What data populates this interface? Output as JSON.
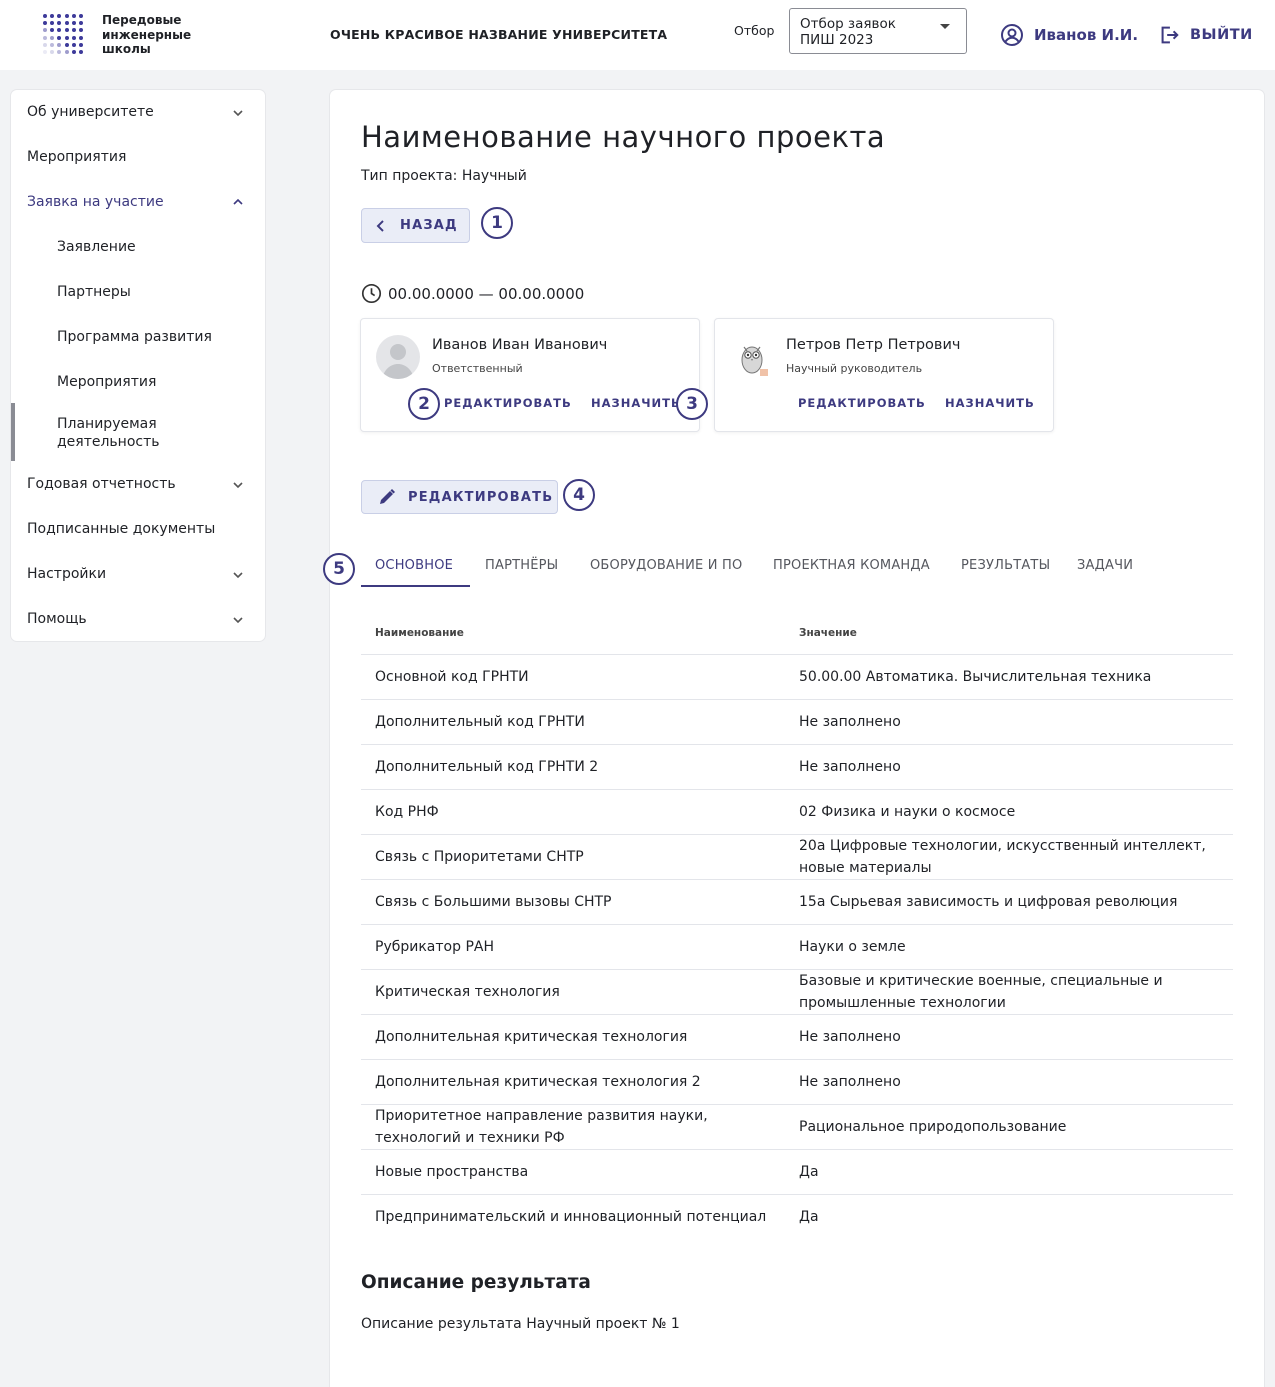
{
  "header": {
    "logo_text_lines": [
      "Передовые",
      "инженерные",
      "школы"
    ],
    "university": "ОЧЕНЬ КРАСИВОЕ НАЗВАНИЕ УНИВЕРСИТЕТА",
    "otbor_label": "Отбор",
    "select_value_line1": "Отбор заявок",
    "select_value_line2": "ПИШ 2023",
    "user_name": "Иванов И.И.",
    "logout": "ВЫЙТИ"
  },
  "sidebar": {
    "items": [
      {
        "label": "Об университете"
      },
      {
        "label": "Мероприятия"
      },
      {
        "label": "Заявка на участие"
      },
      {
        "label": "Годовая отчетность"
      },
      {
        "label": "Подписанные документы"
      },
      {
        "label": "Настройки"
      },
      {
        "label": "Помощь"
      }
    ],
    "subitems": [
      {
        "label": "Заявление"
      },
      {
        "label": "Партнеры"
      },
      {
        "label": "Программа развития"
      },
      {
        "label": "Мероприятия"
      },
      {
        "label": "Планируемая деятельность"
      }
    ]
  },
  "project": {
    "title": "Наименование научного проекта",
    "type": "Тип проекта: Научный",
    "back_label": "НАЗАД",
    "dates": "00.00.0000 — 00.00.0000",
    "edit_label": "РЕДАКТИРОВАТЬ"
  },
  "markers": [
    "1",
    "2",
    "3",
    "4",
    "5"
  ],
  "persons": [
    {
      "name": "Иванов Иван Иванович",
      "role": "Ответственный",
      "edit": "РЕДАКТИРОВАТЬ",
      "assign": "НАЗНАЧИТЬ"
    },
    {
      "name": "Петров Петр Петрович",
      "role": "Научный руководитель",
      "edit": "РЕДАКТИРОВАТЬ",
      "assign": "НАЗНАЧИТЬ"
    }
  ],
  "tabs": [
    {
      "label": "ОСНОВНОЕ"
    },
    {
      "label": "ПАРТНЁРЫ"
    },
    {
      "label": "ОБОРУДОВАНИЕ И ПО"
    },
    {
      "label": "ПРОЕКТНАЯ КОМАНДА"
    },
    {
      "label": "РЕЗУЛЬТАТЫ"
    },
    {
      "label": "ЗАДАЧИ"
    }
  ],
  "table": {
    "headers": [
      "Наименование",
      "Значение"
    ],
    "rows": [
      [
        "Основной код ГРНТИ",
        "50.00.00 Автоматика. Вычислительная техника"
      ],
      [
        "Дополнительный код ГРНТИ",
        "Не заполнено"
      ],
      [
        "Дополнительный код ГРНТИ 2",
        "Не заполнено"
      ],
      [
        "Код РНФ",
        "02 Физика и науки о космосе"
      ],
      [
        "Связь с Приоритетами СНТР",
        "20а Цифровые технологии, искусственный интеллект, новые материалы"
      ],
      [
        "Связь с Большими вызовы СНТР",
        "15а Сырьевая зависимость и цифровая революция"
      ],
      [
        "Рубрикатор РАН",
        "Науки о земле"
      ],
      [
        "Критическая технология",
        "Базовые и критические военные, специальные и промышленные технологии"
      ],
      [
        "Дополнительная критическая технология",
        "Не заполнено"
      ],
      [
        "Дополнительная критическая технология 2",
        "Не заполнено"
      ],
      [
        "Приоритетное направление развития науки, технологий и техники РФ",
        "Рациональное природопользование"
      ],
      [
        "Новые пространства",
        "Да"
      ],
      [
        "Предпринимательский и инновационный потенциал",
        "Да"
      ]
    ]
  },
  "result": {
    "heading": "Описание результата",
    "text": "Описание результата Научный проект № 1"
  },
  "colors": {
    "accent": "#3d3a80",
    "background": "#f2f3f5",
    "button_bg": "#eaedf7"
  }
}
